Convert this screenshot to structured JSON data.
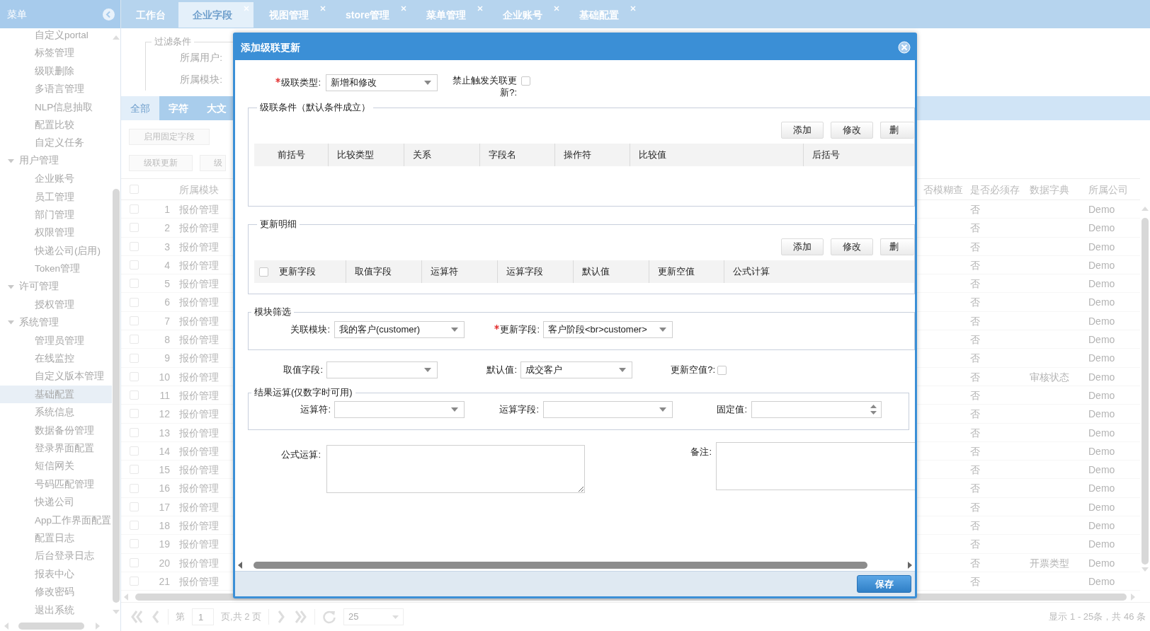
{
  "sidebar": {
    "title": "菜单",
    "items": [
      {
        "label": "自定义portal",
        "selected": false
      },
      {
        "label": "标签管理",
        "selected": false
      },
      {
        "label": "级联删除",
        "selected": false
      },
      {
        "label": "多语言管理",
        "selected": false
      },
      {
        "label": "NLP信息抽取",
        "selected": false
      },
      {
        "label": "配置比较",
        "selected": false
      },
      {
        "label": "自定义任务",
        "selected": false
      },
      {
        "label": "用户管理",
        "expanded": true,
        "children": [
          {
            "label": "企业账号",
            "selected": false
          },
          {
            "label": "员工管理",
            "selected": false
          },
          {
            "label": "部门管理",
            "selected": false
          },
          {
            "label": "权限管理",
            "selected": false
          },
          {
            "label": "快递公司(启用)",
            "selected": false
          },
          {
            "label": "Token管理",
            "selected": false
          }
        ]
      },
      {
        "label": "许可管理",
        "expanded": true,
        "children": [
          {
            "label": "授权管理",
            "selected": false
          }
        ]
      },
      {
        "label": "系统管理",
        "expanded": true,
        "children": [
          {
            "label": "管理员管理",
            "selected": false
          },
          {
            "label": "在线监控",
            "selected": false
          },
          {
            "label": "自定义版本管理",
            "selected": false
          },
          {
            "label": "基础配置",
            "selected": true
          },
          {
            "label": "系统信息",
            "selected": false
          },
          {
            "label": "数据备份管理",
            "selected": false
          },
          {
            "label": "登录界面配置",
            "selected": false
          },
          {
            "label": "短信网关",
            "selected": false
          },
          {
            "label": "号码匹配管理",
            "selected": false
          },
          {
            "label": "快递公司",
            "selected": false
          },
          {
            "label": "App工作界面配置",
            "selected": false
          },
          {
            "label": "配置日志",
            "selected": false
          },
          {
            "label": "后台登录日志",
            "selected": false
          },
          {
            "label": "报表中心",
            "selected": false
          },
          {
            "label": "修改密码",
            "selected": false
          },
          {
            "label": "退出系统",
            "selected": false
          }
        ]
      }
    ]
  },
  "tabs": [
    {
      "label": "工作台",
      "selected": false,
      "closable": false
    },
    {
      "label": "企业字段",
      "selected": true,
      "closable": true
    },
    {
      "label": "视图管理",
      "selected": false,
      "closable": true
    },
    {
      "label": "store管理",
      "selected": false,
      "closable": true
    },
    {
      "label": "菜单管理",
      "selected": false,
      "closable": true
    },
    {
      "label": "企业账号",
      "selected": false,
      "closable": true
    },
    {
      "label": "基础配置",
      "selected": false,
      "closable": true
    }
  ],
  "filter": {
    "legend": "过滤条件",
    "labels": [
      "所属用户:",
      "所属模块:"
    ]
  },
  "type_tabs": [
    {
      "label": "全部",
      "selected": true
    },
    {
      "label": "字符",
      "selected": false
    },
    {
      "label": "大文",
      "selected": false
    }
  ],
  "toolbar_rows": [
    [
      "启用固定字段"
    ],
    [
      "级联更新",
      "级"
    ]
  ],
  "table": {
    "columns": [
      "所属模块",
      "否模糊查",
      "是否必须存",
      "数据字典",
      "所属公司"
    ],
    "header_checked": false,
    "rows": [
      {
        "checked": false,
        "number": "1",
        "module": "报价管理",
        "required": "否",
        "company": "Demo"
      },
      {
        "checked": false,
        "number": "2",
        "module": "报价管理",
        "required": "否",
        "company": "Demo"
      },
      {
        "checked": false,
        "number": "3",
        "module": "报价管理",
        "required": "否",
        "company": "Demo"
      },
      {
        "checked": false,
        "number": "4",
        "module": "报价管理",
        "required": "否",
        "company": "Demo"
      },
      {
        "checked": false,
        "number": "5",
        "module": "报价管理",
        "required": "否",
        "company": "Demo"
      },
      {
        "checked": false,
        "number": "6",
        "module": "报价管理",
        "required": "否",
        "company": "Demo"
      },
      {
        "checked": false,
        "number": "7",
        "module": "报价管理",
        "required": "否",
        "company": "Demo"
      },
      {
        "checked": false,
        "number": "8",
        "module": "报价管理",
        "required": "否",
        "company": "Demo"
      },
      {
        "checked": false,
        "number": "9",
        "module": "报价管理",
        "required": "否",
        "company": "Demo"
      },
      {
        "checked": false,
        "number": "10",
        "module": "报价管理",
        "required": "否",
        "dictionary": "审核状态",
        "company": "Demo"
      },
      {
        "checked": false,
        "number": "11",
        "module": "报价管理",
        "required": "否",
        "company": "Demo"
      },
      {
        "checked": false,
        "number": "12",
        "module": "报价管理",
        "required": "否",
        "company": "Demo"
      },
      {
        "checked": false,
        "number": "13",
        "module": "报价管理",
        "required": "否",
        "company": "Demo"
      },
      {
        "checked": false,
        "number": "14",
        "module": "报价管理",
        "required": "否",
        "company": "Demo"
      },
      {
        "checked": false,
        "number": "15",
        "module": "报价管理",
        "required": "否",
        "company": "Demo"
      },
      {
        "checked": false,
        "number": "16",
        "module": "报价管理",
        "required": "否",
        "company": "Demo"
      },
      {
        "checked": false,
        "number": "17",
        "module": "报价管理",
        "required": "否",
        "company": "Demo"
      },
      {
        "checked": false,
        "number": "18",
        "module": "报价管理",
        "required": "否",
        "company": "Demo"
      },
      {
        "checked": false,
        "number": "19",
        "module": "报价管理",
        "required": "否",
        "company": "Demo"
      },
      {
        "checked": false,
        "number": "20",
        "module": "报价管理",
        "required": "否",
        "dictionary": "开票类型",
        "company": "Demo"
      },
      {
        "checked": false,
        "number": "21",
        "module": "报价管理",
        "required": "否",
        "company": "Demo"
      }
    ]
  },
  "pagination": {
    "page_prefix": "第",
    "page": "1",
    "page_suffix": "页,共 2 页",
    "page_size": "25",
    "summary": "显示 1 - 25条，共 46 条"
  },
  "dialog": {
    "title": "添加级联更新",
    "cascade_type": {
      "label": "级联类型:",
      "required": true,
      "value": "新增和修改"
    },
    "no_trigger": {
      "label": "禁止触发关联更新?:",
      "checked": false
    },
    "conditions": {
      "legend": "级联条件（默认条件成立）",
      "buttons": [
        "添加",
        "修改",
        "删"
      ],
      "columns": [
        "前括号",
        "比较类型",
        "关系",
        "字段名",
        "操作符",
        "比较值",
        "后括号"
      ]
    },
    "details": {
      "legend": "更新明细",
      "buttons": [
        "添加",
        "修改",
        "删"
      ],
      "header_checked": false,
      "columns": [
        "更新字段",
        "取值字段",
        "运算符",
        "运算字段",
        "默认值",
        "更新空值",
        "公式计算"
      ]
    },
    "module_filter": {
      "legend": "模块筛选",
      "fields": [
        {
          "label": "关联模块:",
          "required": false,
          "value": "我的客户(customer)"
        },
        {
          "label": "更新字段:",
          "required": true,
          "value": "客户阶段<br>customer>"
        }
      ]
    },
    "value_fields": [
      {
        "label": "取值字段:",
        "required": false
      },
      {
        "label": "默认值:",
        "required": false,
        "value": "成交客户"
      }
    ],
    "update_null": {
      "label": "更新空值?:",
      "checked": false
    },
    "result": {
      "legend": "结果运算(仅数字时可用)",
      "fields": [
        {
          "label": "运算符:",
          "kind": "select"
        },
        {
          "label": "运算字段:",
          "kind": "select"
        },
        {
          "label": "固定值:",
          "kind": "number"
        }
      ]
    },
    "formula": {
      "label": "公式运算:"
    },
    "remark": {
      "label": "备注:"
    },
    "save": "保存"
  }
}
